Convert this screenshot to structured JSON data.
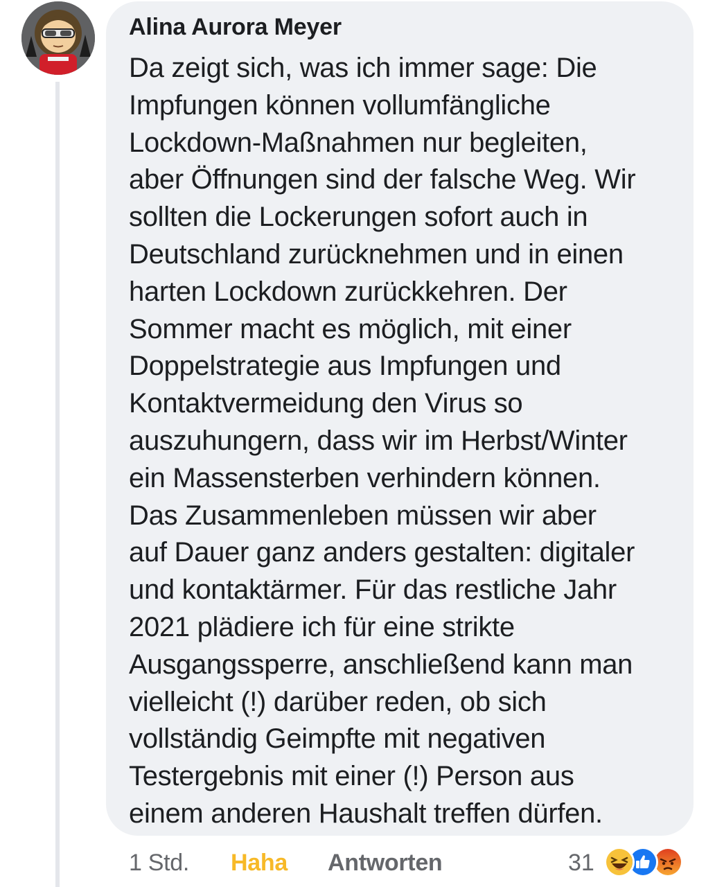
{
  "comment": {
    "author": "Alina Aurora Meyer",
    "lines": [
      "Da zeigt sich, was ich immer sage: Die",
      "Impfungen können vollumfängliche",
      "Lockdown-Maßnahmen nur begleiten,",
      "aber Öffnungen sind der falsche Weg. Wir",
      "sollten die Lockerungen sofort auch in",
      "Deutschland zurücknehmen und in einen",
      "harten Lockdown zurückkehren. Der",
      "Sommer macht es möglich, mit einer",
      "Doppelstrategie aus Impfungen und",
      "Kontaktvermeidung den Virus so",
      "auszuhungern, dass wir im Herbst/Winter",
      "ein Massensterben verhindern können.",
      "Das Zusammenleben müssen wir aber",
      "auf Dauer ganz anders gestalten: digitaler",
      "und kontaktärmer. Für das restliche Jahr",
      "2021 plädiere ich für eine strikte",
      "Ausgangssperre, anschließend kann man",
      "vielleicht (!) darüber reden, ob sich",
      "vollständig Geimpfte mit negativen",
      "Testergebnis mit einer (!) Person aus",
      "einem anderen Haushalt treffen dürfen."
    ]
  },
  "actions": {
    "time": "1 Std.",
    "reaction": "Haha",
    "reply": "Antworten"
  },
  "reactions": {
    "count": "31",
    "icons": [
      "haha-icon",
      "like-icon",
      "angry-icon"
    ]
  },
  "colors": {
    "bubble": "#eff1f4",
    "text": "#1c1e21",
    "secondary": "#65676b",
    "haha": "#f7b928",
    "like": "#1877f2",
    "angry": "#e9710f"
  }
}
